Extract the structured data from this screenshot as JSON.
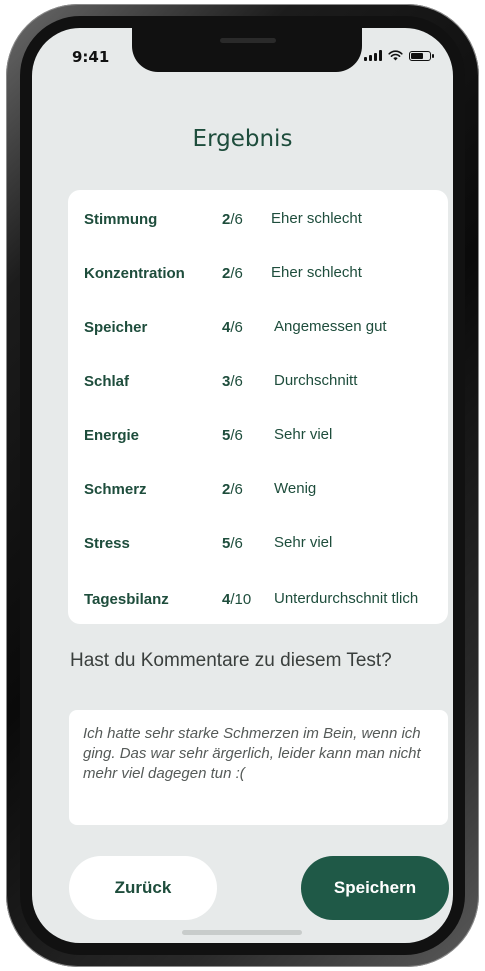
{
  "status_bar": {
    "time": "9:41"
  },
  "header": {
    "title": "Ergebnis"
  },
  "results": [
    {
      "name": "Stimmung",
      "score": "2",
      "scale": "/6",
      "description": "Eher schlecht"
    },
    {
      "name": "Konzentration",
      "score": "2",
      "scale": "/6",
      "description": "Eher schlecht"
    },
    {
      "name": "Speicher",
      "score": "4",
      "scale": "/6",
      "description": "Angemessen gut"
    },
    {
      "name": "Schlaf",
      "score": "3",
      "scale": "/6",
      "description": "Durchschnitt"
    },
    {
      "name": "Energie",
      "score": "5",
      "scale": "/6",
      "description": "Sehr viel"
    },
    {
      "name": "Schmerz",
      "score": "2",
      "scale": "/6",
      "description": "Wenig"
    },
    {
      "name": "Stress",
      "score": "5",
      "scale": "/6",
      "description": "Sehr viel"
    },
    {
      "name": "Tagesbilanz",
      "score": "4",
      "scale": "/10",
      "description": "Unterdurchschnit tlich"
    }
  ],
  "comment": {
    "heading": "Hast du Kommentare zu diesem Test?",
    "value": "Ich hatte sehr starke Schmerzen im Bein, wenn ich ging. Das war sehr ärgerlich, leider kann man nicht mehr viel dagegen tun :("
  },
  "actions": {
    "back_label": "Zurück",
    "save_label": "Speichern"
  },
  "colors": {
    "accent": "#1f5947",
    "text_green": "#1e4d3c",
    "background": "#e7eaea"
  },
  "icons": [
    "signal-icon",
    "wifi-icon",
    "battery-icon"
  ]
}
